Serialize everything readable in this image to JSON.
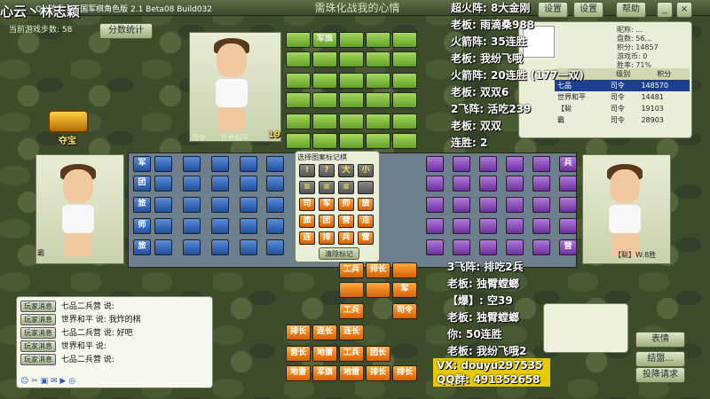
{
  "window": {
    "title": "QQ游戏 - 四国军棋角色版 2.1 Beta08 Build032"
  },
  "stream_overlay": {
    "top_left": "心云丶林志颖",
    "right_lines": [
      "超火阵: 8大金刚",
      "老板: 雨滴桑988",
      "火箭阵: 35连胜",
      "老板: 我纷飞哦",
      "火箭阵: 20连胜 (177一双)",
      "老板: 双双6",
      "2飞阵: 活吃239",
      "老板: 双双",
      "连胜: 2"
    ],
    "bottom_lines": [
      "3飞阵: 排吃2兵",
      "老板: 独臂螳螂",
      "【爆】: 空39",
      "老板: 独臂螳螂",
      "你: 50连胜",
      "老板: 我纷飞哦2"
    ],
    "vx": "VX: douyu297535",
    "qq": "QQ群: 491352658"
  },
  "header": {
    "banner": "需珠化战我的心情",
    "buttons": [
      "设置",
      "设置",
      "帮助"
    ],
    "steps_label": "当前游戏步数: 58",
    "score_btn": "分数统计"
  },
  "treasure": {
    "label": "夺宝"
  },
  "players": {
    "top": {
      "rank": "司令",
      "name": "世界和平",
      "badge": "19"
    },
    "left": {
      "rank": "司令",
      "name": "霸"
    },
    "right": {
      "rank": "司令",
      "name": "【聪】W:8胜"
    }
  },
  "stats_panel": {
    "fields": [
      {
        "label": "昵称:",
        "value": "..."
      },
      {
        "label": "盘数:",
        "value": "56..."
      },
      {
        "label": "积分:",
        "value": "14857"
      },
      {
        "label": "游戏币:",
        "value": "0"
      },
      {
        "label": "胜率:",
        "value": "71%"
      }
    ],
    "table_headers": [
      "",
      "级别",
      "积分"
    ],
    "rows": [
      {
        "name": "七品",
        "rank": "司令",
        "score": "148570",
        "selected": true
      },
      {
        "name": "世界和平",
        "rank": "司令",
        "score": "14481"
      },
      {
        "name": "【聪",
        "rank": "司令",
        "score": "19103"
      },
      {
        "name": "霸",
        "rank": "司令",
        "score": "28903"
      }
    ]
  },
  "mark_popup": {
    "title": "选择图案标记棋",
    "row1": [
      "!",
      "?",
      "大",
      "小"
    ],
    "row2": [
      "≡",
      "≡",
      "≡",
      ""
    ],
    "row3": [
      "司",
      "军",
      "师",
      "旅"
    ],
    "row4": [
      "旅",
      "团",
      "营",
      "连"
    ],
    "row5": [
      "连",
      "排",
      "兵",
      "雷"
    ],
    "clear": "清除标记"
  },
  "board": {
    "top_col": [
      "军旗",
      "",
      "",
      "",
      "",
      ""
    ],
    "bottom_pieces": [
      [
        "工兵",
        "师长",
        ""
      ],
      [
        "",
        "",
        "军"
      ],
      [
        "工兵",
        "",
        "司令"
      ],
      [
        "排长",
        "连长",
        "连长"
      ],
      [
        "营长",
        "地雷",
        "工兵",
        "团长"
      ],
      [
        "地雷",
        "军旗",
        "地雷",
        "排长",
        "排长"
      ]
    ],
    "left_labels": [
      "军",
      "团",
      "旅",
      "师",
      "旅"
    ],
    "right_labels": [
      "兵",
      "",
      "",
      "",
      "营"
    ]
  },
  "chat": {
    "messages": [
      {
        "tag": "玩家消息",
        "name": "七品二兵营",
        "text": "说:"
      },
      {
        "tag": "玩家消息",
        "name": "世界和平",
        "text": "说: 我炸的棋"
      },
      {
        "tag": "玩家消息",
        "name": "七品二兵营",
        "text": "说: 好吧"
      },
      {
        "tag": "玩家消息",
        "name": "世界和平",
        "text": "说:"
      },
      {
        "tag": "玩家消息",
        "name": "七品二兵营",
        "text": "说:"
      }
    ]
  },
  "right_buttons": [
    "表情",
    "结盟...",
    "投降请求"
  ],
  "colors": {
    "green": "#62a224",
    "orange": "#d76000",
    "blue": "#1f4f9e",
    "purple": "#6f2fa0"
  }
}
